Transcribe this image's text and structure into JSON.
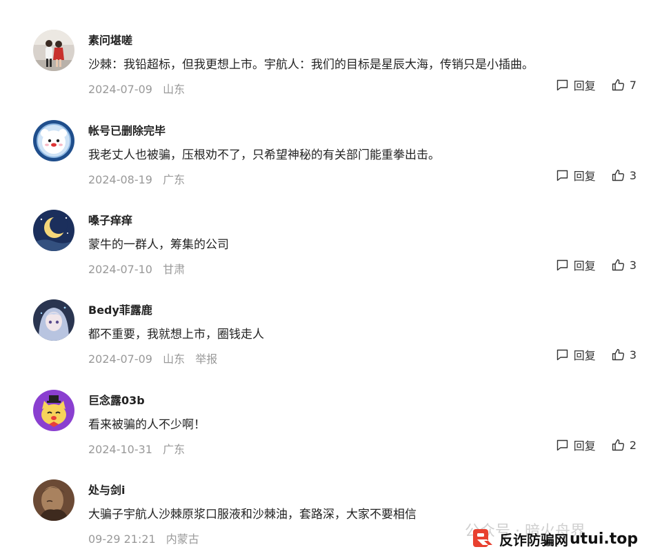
{
  "comments": [
    {
      "name": "素问堪嗟",
      "text": "沙棘：我铅超标，但我更想上市。宇航人：我们的目标是星辰大海，传销只是小插曲。",
      "date": "2024-07-09",
      "location": "山东",
      "report": "",
      "reply_label": "回复",
      "likes": "7",
      "avatar": "couple-photo"
    },
    {
      "name": "帐号已删除完毕",
      "text": "我老丈人也被骗，压根劝不了，只希望神秘的有关部门能重拳出击。",
      "date": "2024-08-19",
      "location": "广东",
      "report": "",
      "reply_label": "回复",
      "likes": "3",
      "avatar": "bear-astronaut"
    },
    {
      "name": "嗓子痒痒",
      "text": "蒙牛的一群人，筹集的公司",
      "date": "2024-07-10",
      "location": "甘肃",
      "report": "",
      "reply_label": "回复",
      "likes": "3",
      "avatar": "crescent-moon"
    },
    {
      "name": "Bedy菲露鹿",
      "text": "都不重要，我就想上市，圈钱走人",
      "date": "2024-07-09",
      "location": "山东",
      "report": "举报",
      "reply_label": "回复",
      "likes": "3",
      "avatar": "anime-girl"
    },
    {
      "name": "巨念露03b",
      "text": "看来被骗的人不少啊！",
      "date": "2024-10-31",
      "location": "广东",
      "report": "",
      "reply_label": "回复",
      "likes": "2",
      "avatar": "cartoon-cat"
    },
    {
      "name": "处与剑i",
      "text": "大骗子宇航人沙棘原浆口服液和沙棘油，套路深，大家不要相信",
      "date": "09-29 21:21",
      "location": "内蒙古",
      "report": "",
      "reply_label": "",
      "likes": "",
      "avatar": "sepia-portrait"
    }
  ],
  "watermark": "公众号 · 暗火舟界",
  "brand": {
    "text": "反诈防骗网",
    "domain": "utui.top"
  },
  "colors": {
    "meta": "#999999",
    "name": "#222222",
    "brand_red": "#e8402f"
  }
}
